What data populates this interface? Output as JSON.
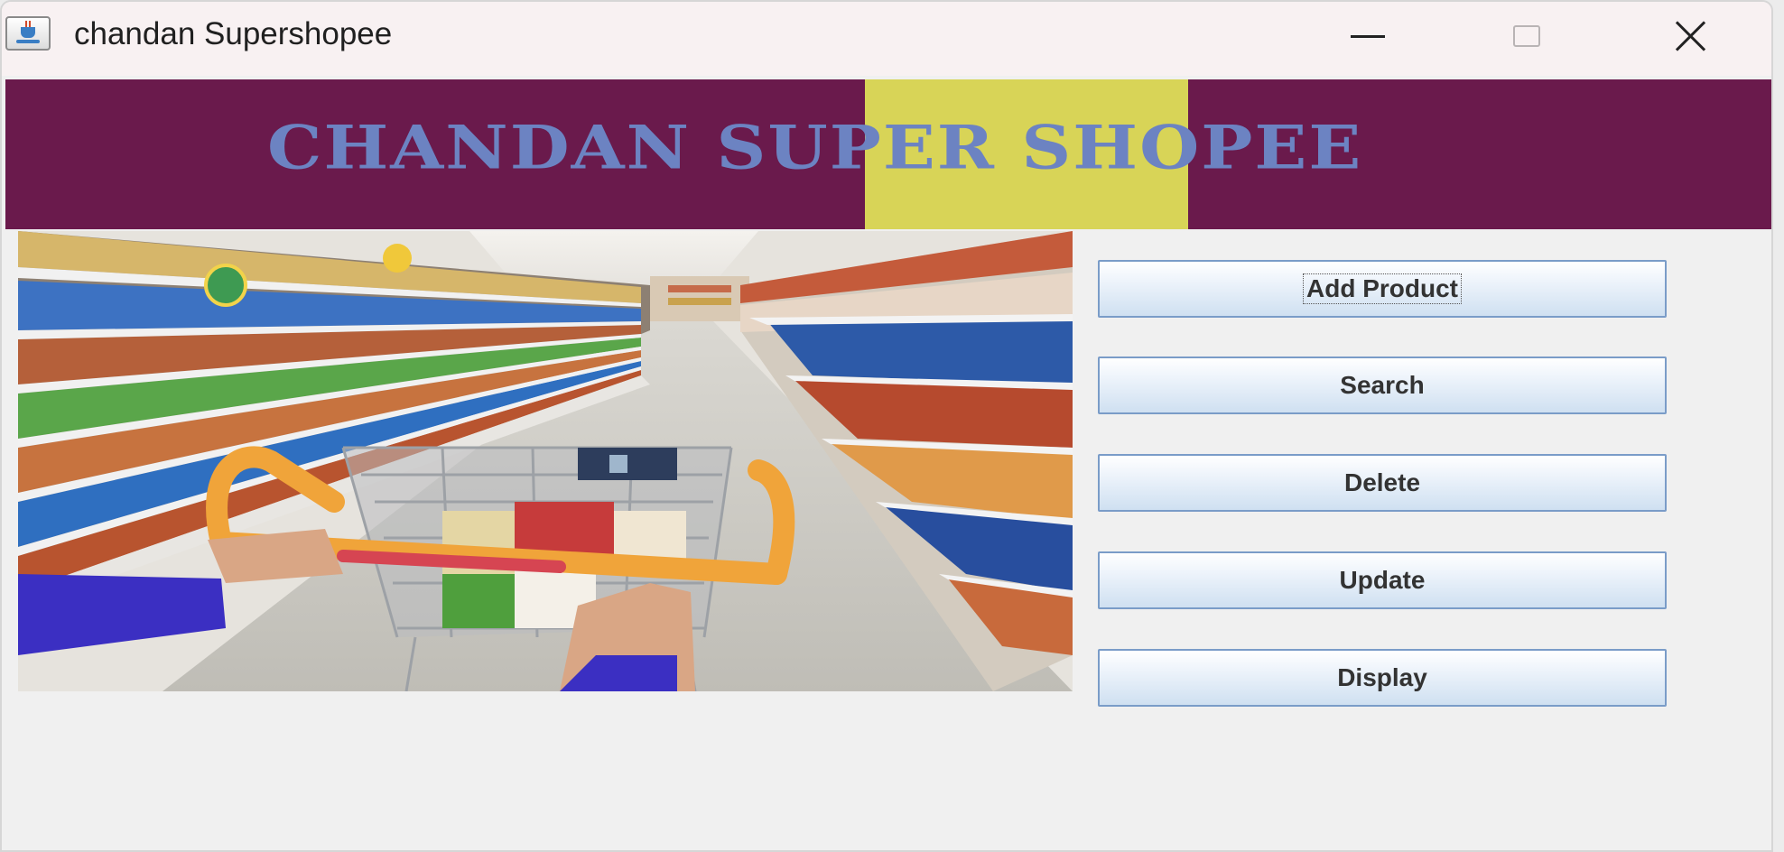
{
  "window": {
    "title": "chandan Supershopee",
    "icon": "java-cup-icon",
    "controls": [
      "minimize",
      "maximize",
      "close"
    ]
  },
  "banner": {
    "title": "CHANDAN SUPER SHOPEE",
    "background_color": "#6a1a4c",
    "highlight_color": "#d8d457",
    "text_color": "#6c83c2"
  },
  "photo": {
    "subject": "supermarket-aisle-shopping-cart"
  },
  "menu": {
    "buttons": [
      {
        "label": "Add Product"
      },
      {
        "label": "Search"
      },
      {
        "label": "Delete"
      },
      {
        "label": "Update"
      },
      {
        "label": "Display"
      }
    ]
  }
}
